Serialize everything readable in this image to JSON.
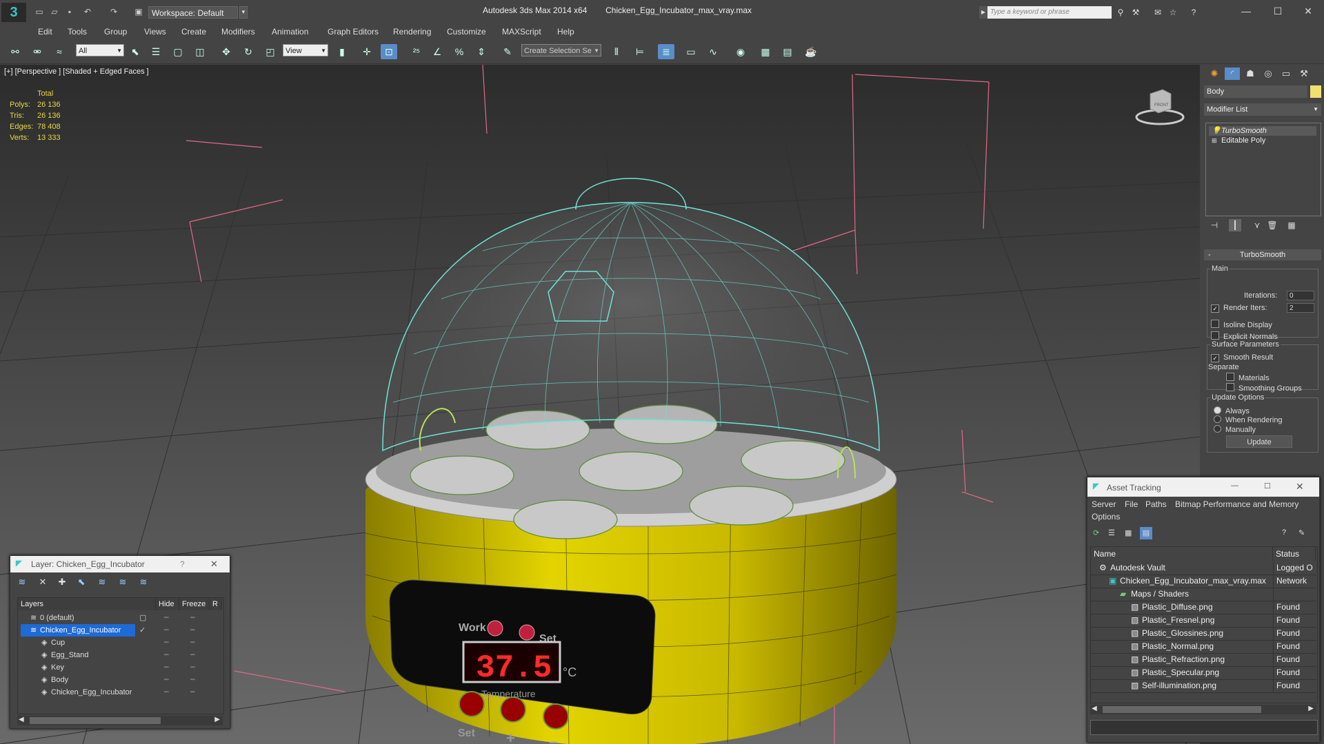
{
  "window": {
    "app_title": "Autodesk 3ds Max  2014 x64",
    "file_title": "Chicken_Egg_Incubator_max_vray.max",
    "workspace": "Workspace: Default",
    "search_placeholder": "Type a keyword or phrase",
    "app_logo": "3"
  },
  "menu": {
    "items": [
      "Edit",
      "Tools",
      "Group",
      "Views",
      "Create",
      "Modifiers",
      "Graph Editors",
      "Animation",
      "Rendering",
      "Customize",
      "MAXScript",
      "Help"
    ]
  },
  "toolbar": {
    "selection_filter": "All",
    "ref_coord": "View",
    "named_selection_placeholder": "Create Selection Se"
  },
  "viewport": {
    "label": "[+] [Perspective ] [Shaded + Edged Faces ]",
    "stats": {
      "header": "Total",
      "polys_label": "Polys:",
      "polys": "26 136",
      "tris_label": "Tris:",
      "tris": "26 136",
      "edges_label": "Edges:",
      "edges": "78 408",
      "verts_label": "Verts:",
      "verts": "13 333"
    },
    "display_temp": "37.5",
    "display_unit": "°C",
    "panel_text_work": "Work",
    "panel_text_set": "Set",
    "panel_text_temperature": "Temperature",
    "panel_text_set2": "Set",
    "panel_text_plus": "+",
    "panel_text_minus": "–",
    "nav_cube_label": "FRONT"
  },
  "command_panel": {
    "object_name": "Body",
    "modifier_list": "Modifier List",
    "stack": [
      "TurboSmooth",
      "Editable Poly"
    ],
    "rollout_title": "TurboSmooth",
    "main_group": "Main",
    "iterations_label": "Iterations:",
    "iterations": "0",
    "render_iters_label": "Render Iters:",
    "render_iters": "2",
    "isoline_display": "Isoline Display",
    "explicit_normals": "Explicit Normals",
    "surface_params": "Surface Parameters",
    "smooth_result": "Smooth Result",
    "separate": "Separate",
    "materials": "Materials",
    "smoothing_groups": "Smoothing Groups",
    "update_options": "Update Options",
    "always": "Always",
    "when_rendering": "When Rendering",
    "manually": "Manually",
    "update_button": "Update"
  },
  "layer_window": {
    "title": "Layer: Chicken_Egg_Incubator",
    "help": "?",
    "close": "✕",
    "columns": {
      "layers": "Layers",
      "hide": "Hide",
      "freeze": "Freeze",
      "render": "R"
    },
    "rows": [
      {
        "name": "0 (default)",
        "indent": 1
      },
      {
        "name": "Chicken_Egg_Incubator",
        "indent": 1,
        "selected": true
      },
      {
        "name": "Cup",
        "indent": 2
      },
      {
        "name": "Egg_Stand",
        "indent": 2
      },
      {
        "name": "Key",
        "indent": 2
      },
      {
        "name": "Body",
        "indent": 2
      },
      {
        "name": "Chicken_Egg_Incubator",
        "indent": 2
      }
    ]
  },
  "asset_window": {
    "title": "Asset Tracking",
    "menu": [
      "Server",
      "File",
      "Paths",
      "Bitmap Performance and Memory",
      "Options"
    ],
    "columns": {
      "name": "Name",
      "status": "Status"
    },
    "rows": [
      {
        "name": "Autodesk Vault",
        "status": "Logged O",
        "indent": 1
      },
      {
        "name": "Chicken_Egg_Incubator_max_vray.max",
        "status": "Network",
        "indent": 2
      },
      {
        "name": "Maps / Shaders",
        "status": "",
        "indent": 3
      },
      {
        "name": "Plastic_Diffuse.png",
        "status": "Found",
        "indent": 4
      },
      {
        "name": "Plastic_Fresnel.png",
        "status": "Found",
        "indent": 4
      },
      {
        "name": "Plastic_Glossines.png",
        "status": "Found",
        "indent": 4
      },
      {
        "name": "Plastic_Normal.png",
        "status": "Found",
        "indent": 4
      },
      {
        "name": "Plastic_Refraction.png",
        "status": "Found",
        "indent": 4
      },
      {
        "name": "Plastic_Specular.png",
        "status": "Found",
        "indent": 4
      },
      {
        "name": "Self-illumination.png",
        "status": "Found",
        "indent": 4
      }
    ]
  },
  "colors": {
    "accent_blue": "#1e6ad6",
    "stats_yellow": "#e8d840",
    "wire_cyan": "#6fe3d8",
    "body_yellow": "#d8c800",
    "led_red": "#ff2a2a"
  }
}
